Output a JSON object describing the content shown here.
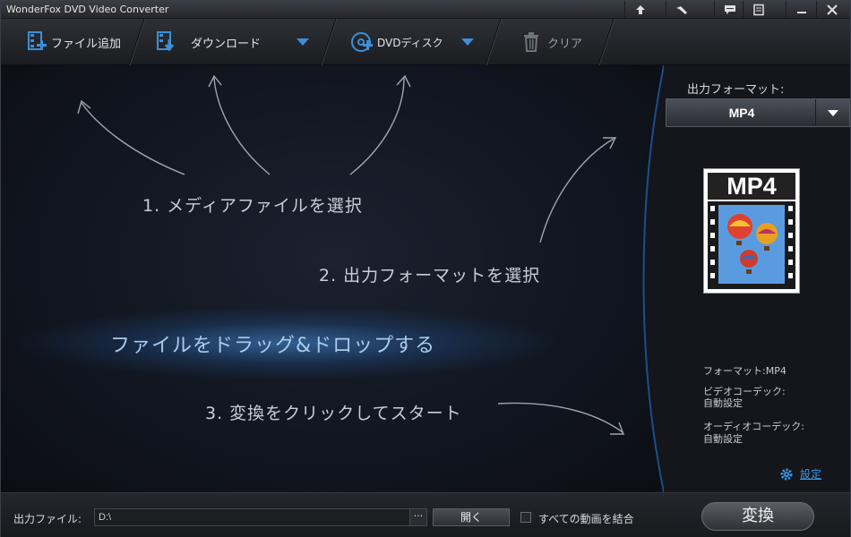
{
  "window": {
    "title": "WonderFox DVD Video Converter"
  },
  "titlebar_buttons": [
    "up-icon",
    "tools-icon",
    "chat-icon",
    "notes-icon",
    "minimize-icon",
    "close-icon"
  ],
  "toolbar": {
    "add_file": "ファイル追加",
    "download": "ダウンロード",
    "dvd_disc": "DVDディスク",
    "clear": "クリア"
  },
  "stage": {
    "step1": "1. メディアファイルを選択",
    "step2": "2. 出力フォーマットを選択",
    "drop_hint": "ファイルをドラッグ&ドロップする",
    "step3": "3. 変換をクリックしてスタート"
  },
  "panel": {
    "output_format_label": "出力フォーマット:",
    "selected_format": "MP4",
    "format_icon_text": "MP4",
    "format_info": "フォーマット:MP4",
    "video_codec_label": "ビデオコーデック:",
    "video_codec_value": "自動設定",
    "audio_codec_label": "オーディオコーデック:",
    "audio_codec_value": "自動設定",
    "settings_link": "設定"
  },
  "bottom": {
    "output_file_label": "出力ファイル:",
    "output_path": "D:\\",
    "browse_label": "···",
    "open_button": "開く",
    "merge_label": "すべての動画を結合",
    "merge_checked": false,
    "convert_button": "変換"
  },
  "colors": {
    "accent": "#3b97e6",
    "background": "#0f1117"
  }
}
